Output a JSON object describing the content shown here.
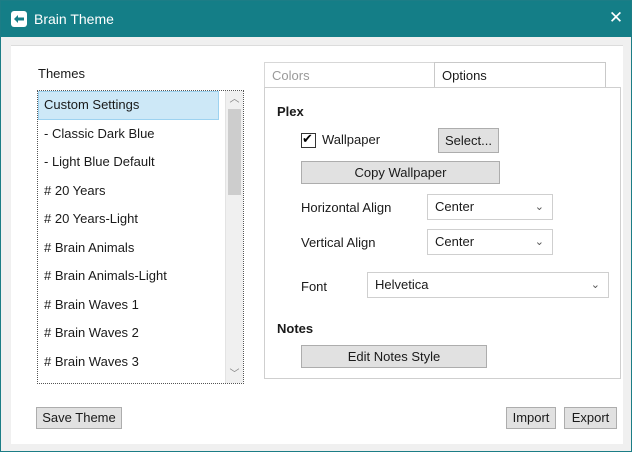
{
  "window": {
    "title": "Brain Theme",
    "close_glyph": "✕",
    "icon": "brain-theme-app-icon"
  },
  "themes": {
    "label": "Themes",
    "items": [
      "Custom Settings",
      "- Classic Dark Blue",
      "- Light Blue Default",
      "# 20 Years",
      "# 20 Years-Light",
      "# Brain Animals",
      "# Brain Animals-Light",
      "# Brain Waves 1",
      "# Brain Waves 2",
      "# Brain Waves 3"
    ],
    "selected_index": 0,
    "scroll_up_glyph": "︿",
    "scroll_down_glyph": "﹀"
  },
  "tabs": [
    {
      "label": "Colors",
      "active": false
    },
    {
      "label": "Options",
      "active": true
    }
  ],
  "options": {
    "plex_heading": "Plex",
    "wallpaper_label": "Wallpaper",
    "wallpaper_checked": true,
    "check_glyph": "✔",
    "select_button": "Select...",
    "copy_wallpaper_button": "Copy Wallpaper",
    "horizontal_align_label": "Horizontal Align",
    "horizontal_align_value": "Center",
    "vertical_align_label": "Vertical Align",
    "vertical_align_value": "Center",
    "font_label": "Font",
    "font_value": "Helvetica",
    "chevron_glyph": "⌄",
    "notes_heading": "Notes",
    "edit_notes_button": "Edit Notes Style"
  },
  "footer": {
    "save_theme": "Save Theme",
    "import": "Import",
    "export": "Export"
  },
  "colors": {
    "titlebar": "#147e87",
    "selection": "#cde8f7"
  }
}
